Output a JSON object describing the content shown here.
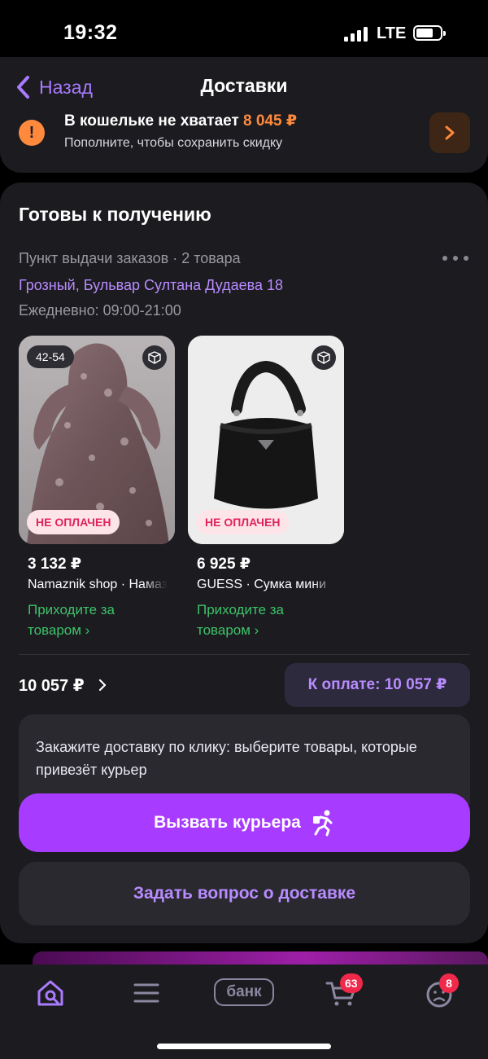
{
  "status_bar": {
    "time": "19:32",
    "network": "LTE"
  },
  "header": {
    "back_label": "Назад",
    "title": "Доставки"
  },
  "wallet_warning": {
    "title": "В кошельке не хватает",
    "amount": "8 045 ₽",
    "subtitle": "Пополните, чтобы сохранить скидку",
    "accent": "#ff8a3d"
  },
  "pickup": {
    "section_title": "Готовы к получению",
    "type_line": "Пункт выдачи заказов · 2 товара",
    "address": "Грозный, Бульвар Султана Дудаева 18",
    "hours": "Ежедневно: 09:00-21:00"
  },
  "products": [
    {
      "size": "42-54",
      "status": "НЕ ОПЛАЧЕН",
      "price": "3 132 ₽",
      "seller": "Namaznik shop · Намазник",
      "link": "Приходите за товаром ›",
      "image": "prayer-dress-photo"
    },
    {
      "size": "",
      "status": "НЕ ОПЛАЧЕН",
      "price": "6 925 ₽",
      "seller": "GUESS · Сумка мини",
      "link": "Приходите за товаром ›",
      "image": "black-handbag-photo"
    }
  ],
  "summary": {
    "total": "10 057 ₽",
    "pay_button": "К оплате: 10 057 ₽"
  },
  "courier": {
    "text": "Закажите доставку по клику: выберите товары, которые привезёт курьер",
    "button": "Вызвать курьера"
  },
  "ask_button": "Задать вопрос о доставке",
  "bottom_nav": {
    "bank_label": "банк",
    "cart_badge": "63",
    "profile_badge": "8"
  },
  "colors": {
    "brand_purple": "#a73bff",
    "link_purple": "#b88cff",
    "success_green": "#3cc36a",
    "badge_red": "#f0294a"
  }
}
